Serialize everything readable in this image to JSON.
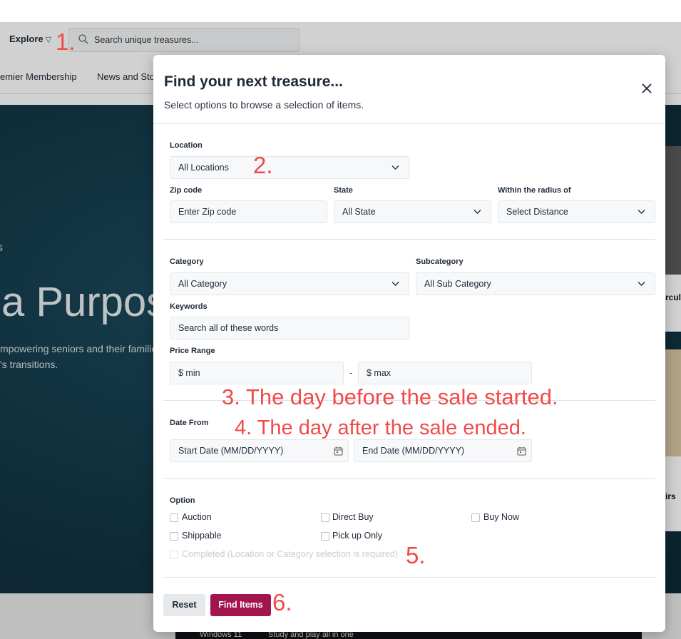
{
  "header": {
    "explore_label": "Explore",
    "explore_icon": "filter-triangle-icon",
    "search_placeholder": "Search unique treasures..."
  },
  "nav": {
    "items": [
      "emier Membership",
      "News and Stor"
    ]
  },
  "hero": {
    "small_text": "s",
    "title": "a Purpos",
    "subtitle_line1": "mpowering seniors and their familie",
    "subtitle_line2": "'s transitions."
  },
  "side_cards": {
    "card1_text": "rcula",
    "card2_text": "irs"
  },
  "bottom_ad": {
    "left_text": "Windows 11",
    "right_text": "Study and play all in one"
  },
  "modal": {
    "title": "Find your next treasure...",
    "subtitle": "Select options to browse a selection of items.",
    "close_icon": "close-icon",
    "location": {
      "label": "Location",
      "value": "All Locations"
    },
    "zip": {
      "label": "Zip code",
      "placeholder": "Enter Zip code"
    },
    "state": {
      "label": "State",
      "value": "All State"
    },
    "radius": {
      "label": "Within the radius of",
      "value": "Select Distance"
    },
    "category": {
      "label": "Category",
      "value": "All Category"
    },
    "subcategory": {
      "label": "Subcategory",
      "value": "All Sub Category"
    },
    "keywords": {
      "label": "Keywords",
      "placeholder": "Search all of these words"
    },
    "price": {
      "label": "Price Range",
      "min_placeholder": "$ min",
      "separator": "-",
      "max_placeholder": "$ max"
    },
    "date": {
      "label": "Date From",
      "start_placeholder": "Start Date (MM/DD/YYYY)",
      "end_placeholder": "End Date (MM/DD/YYYY)"
    },
    "options": {
      "label": "Option",
      "auction": "Auction",
      "direct_buy": "Direct Buy",
      "buy_now": "Buy Now",
      "shippable": "Shippable",
      "pick_up": "Pick up Only",
      "completed": "Completed (Location or Category selection is required)"
    },
    "buttons": {
      "reset": "Reset",
      "find": "Find Items"
    }
  },
  "annotations": {
    "a1": "1.",
    "a2": "2.",
    "a3": "3. The day before the sale started.",
    "a4": "4. The day after the sale ended.",
    "a5": "5.",
    "a6": "6."
  },
  "colors": {
    "accent": "#a3154f",
    "annotation": "#f04a4a",
    "hero_bg": "#143a4a"
  }
}
